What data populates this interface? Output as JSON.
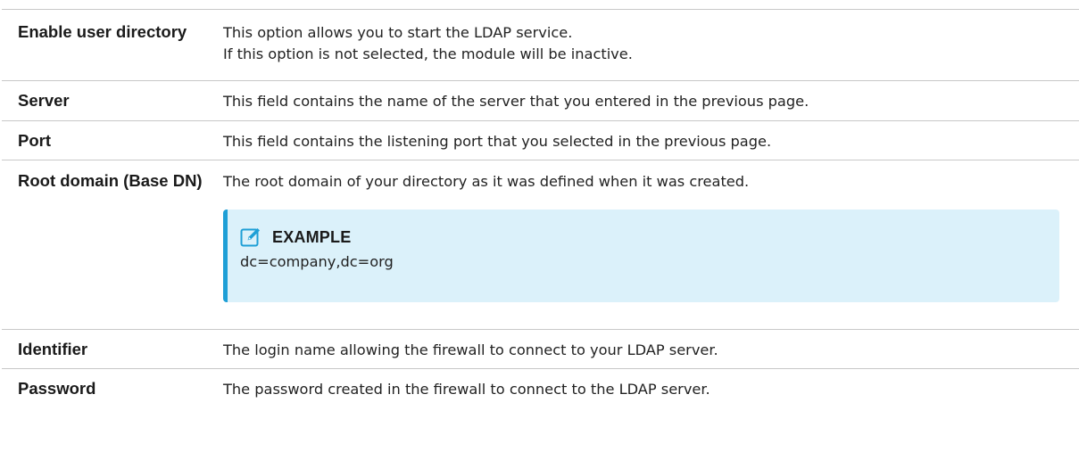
{
  "rows": [
    {
      "term": "Enable user directory",
      "lines": [
        "This option allows you to start the LDAP service.",
        "If this option is not selected, the module will be inactive."
      ]
    },
    {
      "term": "Server",
      "lines": [
        "This field contains the name of the server that you entered in the previous page."
      ]
    },
    {
      "term": "Port",
      "lines": [
        "This field contains the listening port that you selected in the previous page."
      ]
    },
    {
      "term": "Root domain (Base DN)",
      "lines": [
        "The root domain of your directory as it was defined when it was created."
      ],
      "example": {
        "icon": "edit-note-icon",
        "title": "EXAMPLE",
        "text": "dc=company,dc=org"
      }
    },
    {
      "term": "Identifier",
      "lines": [
        "The login name allowing the firewall to connect to your LDAP server."
      ]
    },
    {
      "term": "Password",
      "lines": [
        "The password created in the firewall to connect to the LDAP server."
      ]
    }
  ],
  "colors": {
    "example_background": "#dbf1fa",
    "example_accent": "#1e9fd6",
    "divider": "#c8c8c8"
  }
}
